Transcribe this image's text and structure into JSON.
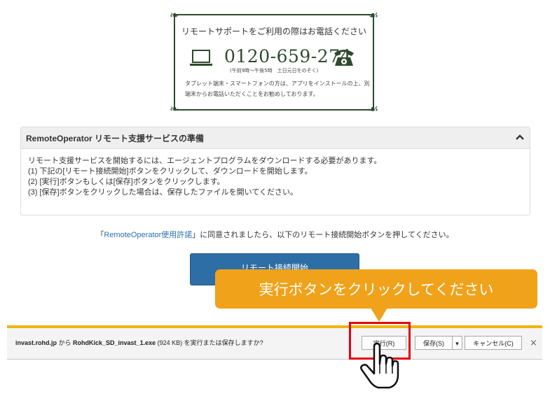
{
  "support": {
    "title": "リモートサポートをご利用の際はお電話ください",
    "phone": "0120-659-274",
    "hours": "(午前9時～午後5時　土日元日をのぞく)",
    "note": "タブレット端末・スマートフォンの方は、アプリをインストールの上、別端末からお電話いただくことをお勧めしております。"
  },
  "panel": {
    "title": "RemoteOperator リモート支援サービスの準備",
    "lines": [
      "リモート支援サービスを開始するには、エージェントプログラムをダウンロードする必要があります。",
      "(1) 下記の[リモート接続開始]ボタンをクリックして、ダウンロードを開始します。",
      "(2) [実行]ボタンもしくは[保存]ボタンをクリックします。",
      "(3) [保存]ボタンをクリックした場合は、保存したファイルを開いてください。"
    ]
  },
  "agreement": {
    "open_bracket": "「",
    "link": "RemoteOperator使用許諾",
    "rest": "」に同意されましたら、以下のリモート接続開始ボタンを押してください。"
  },
  "start_button": {
    "label": "リモート接続開始"
  },
  "callout": {
    "text": "実行ボタンをクリックしてください"
  },
  "download_bar": {
    "host": "invast.rohd.jp",
    "from": " から ",
    "filename": "RohdKick_SD_invast_1.exe",
    "size": " (924 KB) ",
    "question": "を実行または保存しますか?",
    "run_label": "実行(R)",
    "save_label": "保存(S)",
    "save_menu": "▾",
    "cancel_label": "キャンセル(C)",
    "close": "×"
  },
  "colors": {
    "accent": "#f0a21a",
    "highlight": "#e60012",
    "button": "#2e6ea6",
    "link": "#2a6fb0"
  },
  "icons": [
    "laptop-icon",
    "telephone-icon",
    "chevron-up-icon",
    "pointer-hand-icon"
  ]
}
